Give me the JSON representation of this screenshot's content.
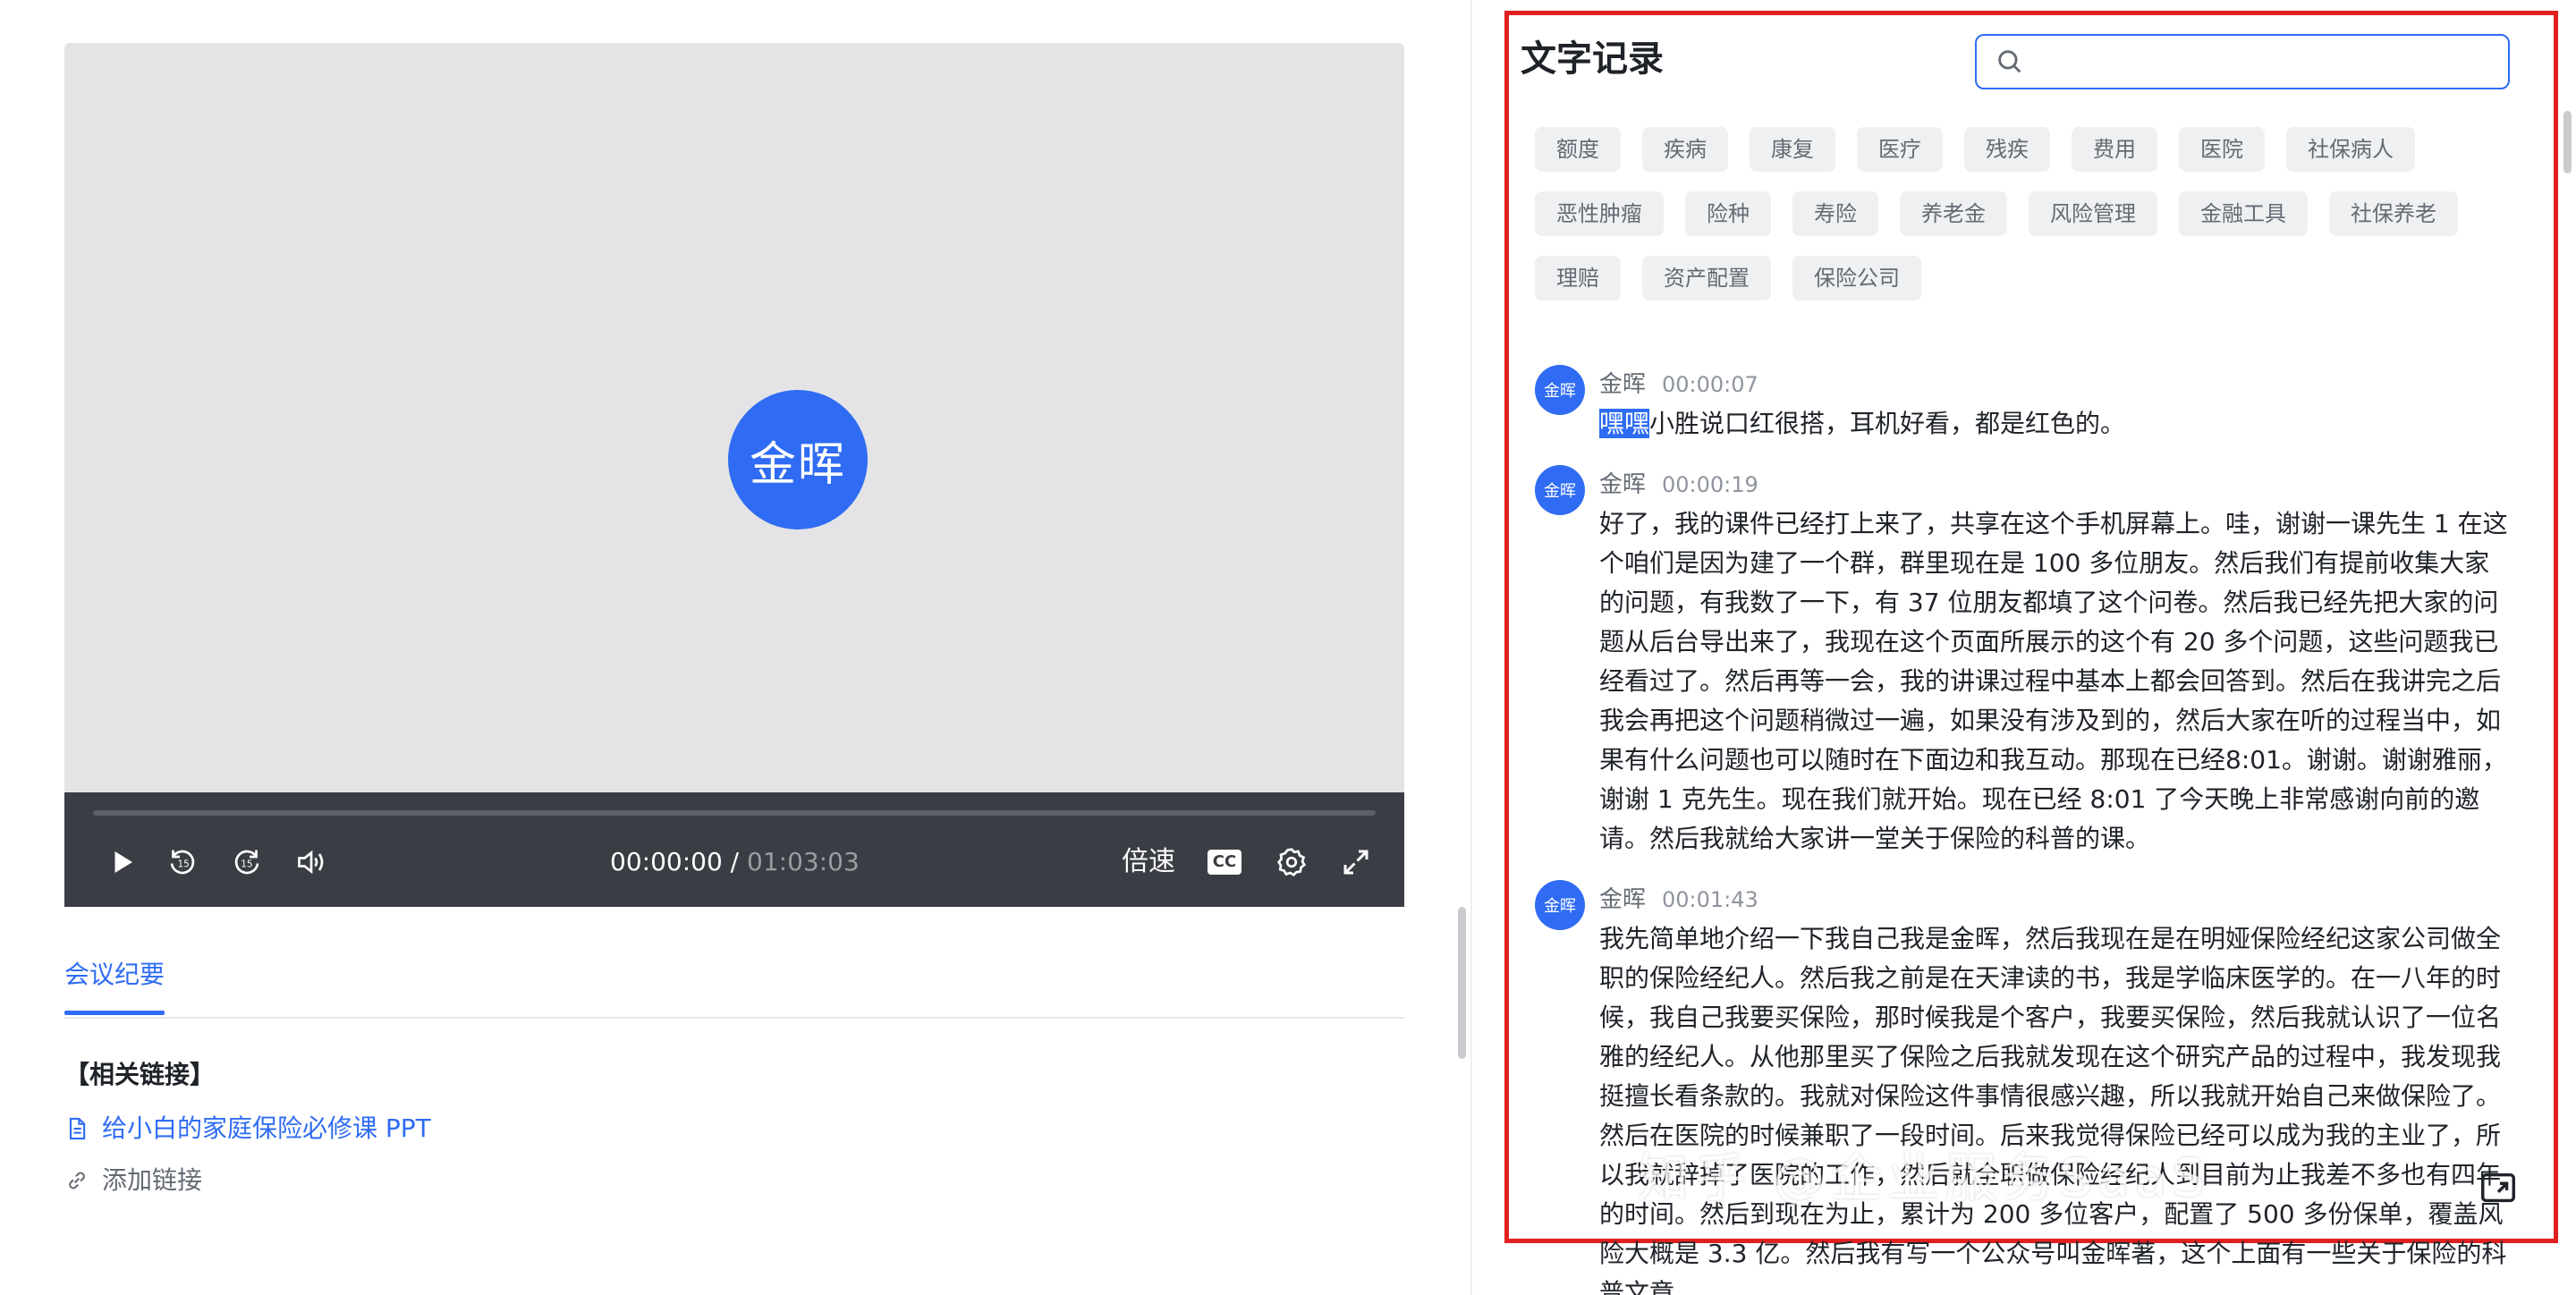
{
  "player": {
    "speaker_avatar": "金晖",
    "time_current": "00:00:00",
    "time_separator": " / ",
    "time_duration": "01:03:03",
    "progress": 0,
    "speed_label": "倍速",
    "cc_label": "CC",
    "icons": [
      "play-icon",
      "rewind-15-icon",
      "forward-15-icon",
      "volume-icon",
      "cc-icon",
      "settings-icon",
      "fullscreen-icon"
    ]
  },
  "tabs": {
    "minutes": "会议纪要"
  },
  "related": {
    "title": "【相关链接】",
    "link": "给小白的家庭保险必修课 PPT",
    "add_link": "添加链接"
  },
  "transcript": {
    "title": "文字记录",
    "search_placeholder": "",
    "tags": [
      "额度",
      "疾病",
      "康复",
      "医疗",
      "残疾",
      "费用",
      "医院",
      "社保病人",
      "恶性肿瘤",
      "险种",
      "寿险",
      "养老金",
      "风险管理",
      "金融工具",
      "社保养老",
      "理赔",
      "资产配置",
      "保险公司"
    ],
    "entries": [
      {
        "avatar": "金晖",
        "speaker": "金晖",
        "time": "00:00:07",
        "highlight": "嘿嘿",
        "text": "小胜说口红很搭，耳机好看，都是红色的。"
      },
      {
        "avatar": "金晖",
        "speaker": "金晖",
        "time": "00:00:19",
        "text": "好了，我的课件已经打上来了，共享在这个手机屏幕上。哇，谢谢一课先生 1 在这个咱们是因为建了一个群，群里现在是 100 多位朋友。然后我们有提前收集大家的问题，有我数了一下，有 37 位朋友都填了这个问卷。然后我已经先把大家的问题从后台导出来了，我现在这个页面所展示的这个有 20 多个问题，这些问题我已经看过了。然后再等一会，我的讲课过程中基本上都会回答到。然后在我讲完之后我会再把这个问题稍微过一遍，如果没有涉及到的，然后大家在听的过程当中，如果有什么问题也可以随时在下面边和我互动。那现在已经8:01。谢谢。谢谢雅丽，谢谢 1 克先生。现在我们就开始。现在已经 8:01 了今天晚上非常感谢向前的邀请。然后我就给大家讲一堂关于保险的科普的课。"
      },
      {
        "avatar": "金晖",
        "speaker": "金晖",
        "time": "00:01:43",
        "text": "我先简单地介绍一下我自己我是金晖，然后我现在是在明娅保险经纪这家公司做全职的保险经纪人。然后我之前是在天津读的书，我是学临床医学的。在一八年的时候，我自己我要买保险，那时候我是个客户，我要买保险，然后我就认识了一位名雅的经纪人。从他那里买了保险之后我就发现在这个研究产品的过程中，我发现我挺擅长看条款的。我就对保险这件事情很感兴趣，所以我就开始自己来做保险了。然后在医院的时候兼职了一段时间。后来我觉得保险已经可以成为我的主业了，所以我就辞掉了医院的工作，然后就全职做保险经纪人到目前为止我差不多也有四年的时间。然后到现在为止，累计为 200 多位客户，配置了 500 多份保单，覆盖风险大概是 3.3 亿。然后我有写一个公众号叫金晖著，这个上面有一些关于保险的科普文章。"
      }
    ]
  },
  "watermark": "知乎 @企业服务SaaS"
}
